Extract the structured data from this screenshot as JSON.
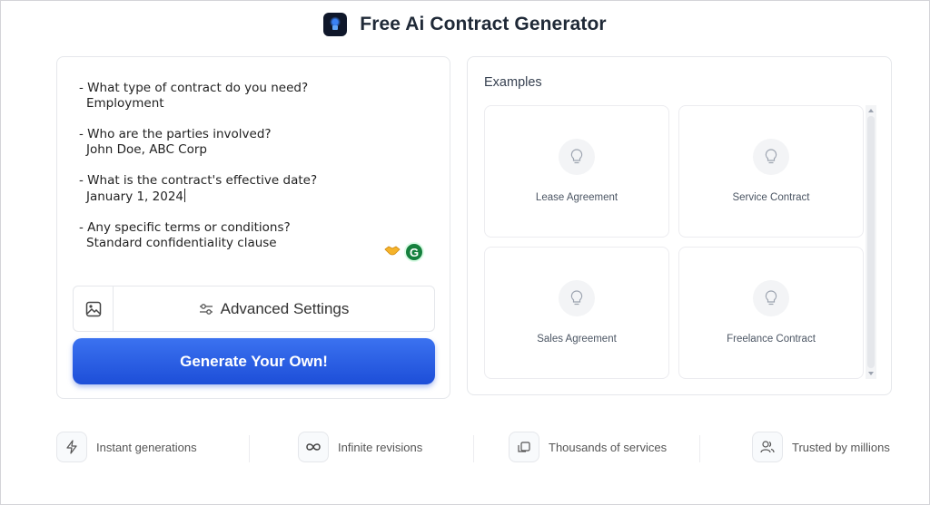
{
  "header": {
    "title": "Free Ai Contract Generator",
    "logo_icon": "app-logo-icon"
  },
  "prompt": {
    "items": [
      {
        "question": "- What type of contract do you need?",
        "answer": "Employment"
      },
      {
        "question": "- Who are the parties involved?",
        "answer": "John Doe, ABC Corp"
      },
      {
        "question": "- What is the contract's effective date?",
        "answer": "January 1, 2024"
      },
      {
        "question": "- Any specific terms or conditions?",
        "answer": "Standard confidentiality clause"
      }
    ],
    "extension_icons": [
      "handshake-icon",
      "grammarly-icon"
    ],
    "grammarly_glyph": "G"
  },
  "controls": {
    "image_button_icon": "image-icon",
    "advanced_settings_label": "Advanced Settings",
    "advanced_settings_icon": "sliders-icon",
    "generate_label": "Generate Your Own!",
    "generate_color": "#2563eb"
  },
  "examples": {
    "title": "Examples",
    "items": [
      {
        "label": "Lease Agreement",
        "icon": "lightbulb-icon"
      },
      {
        "label": "Service Contract",
        "icon": "lightbulb-icon"
      },
      {
        "label": "Sales Agreement",
        "icon": "lightbulb-icon"
      },
      {
        "label": "Freelance Contract",
        "icon": "lightbulb-icon"
      }
    ]
  },
  "features": [
    {
      "label": "Instant generations",
      "icon": "lightning-icon"
    },
    {
      "label": "Infinite revisions",
      "icon": "infinity-icon"
    },
    {
      "label": "Thousands of services",
      "icon": "copy-icon"
    },
    {
      "label": "Trusted by millions",
      "icon": "users-icon"
    }
  ]
}
